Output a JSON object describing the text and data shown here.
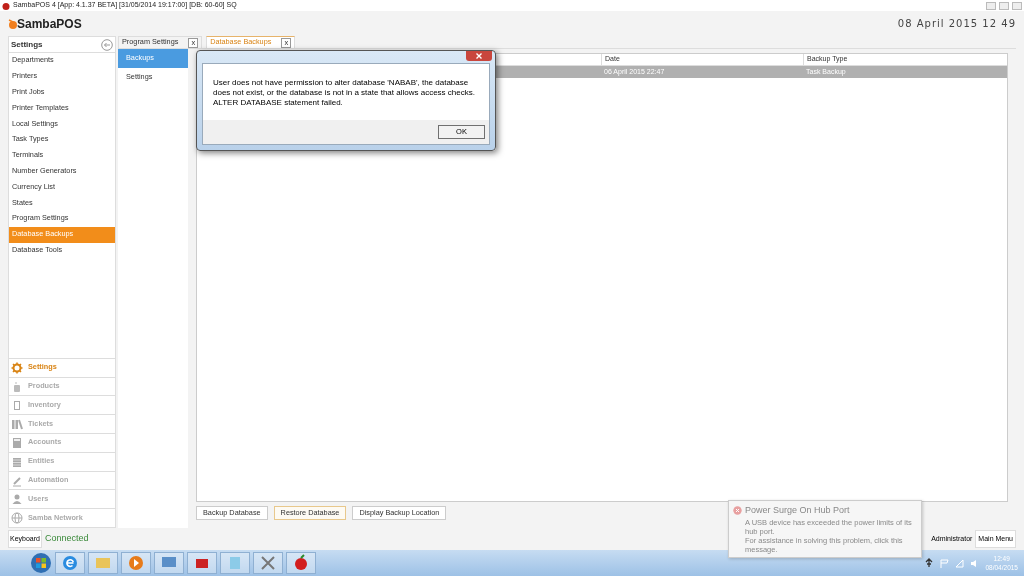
{
  "window": {
    "title": "SambaPOS 4 [App: 4.1.37 BETA] [31/05/2014 19:17:00] [DB: 60-60] SQ"
  },
  "header": {
    "logo": "SambaPOS",
    "clock": "08 April 2015 12 49"
  },
  "sidebar": {
    "title": "Settings",
    "items": [
      {
        "label": "Departments",
        "selected": false
      },
      {
        "label": "Printers",
        "selected": false
      },
      {
        "label": "Print Jobs",
        "selected": false
      },
      {
        "label": "Printer Templates",
        "selected": false
      },
      {
        "label": "Local Settings",
        "selected": false
      },
      {
        "label": "Task Types",
        "selected": false
      },
      {
        "label": "Terminals",
        "selected": false
      },
      {
        "label": "Number Generators",
        "selected": false
      },
      {
        "label": "Currency List",
        "selected": false
      },
      {
        "label": "States",
        "selected": false
      },
      {
        "label": "Program Settings",
        "selected": false
      },
      {
        "label": "Database Backups",
        "selected": true
      },
      {
        "label": "Database Tools",
        "selected": false
      }
    ]
  },
  "modules": [
    {
      "label": "Settings",
      "kind": "gear",
      "selected": true
    },
    {
      "label": "Products",
      "kind": "cup",
      "selected": false
    },
    {
      "label": "Inventory",
      "kind": "box",
      "selected": false
    },
    {
      "label": "Tickets",
      "kind": "books",
      "selected": false
    },
    {
      "label": "Accounts",
      "kind": "calculator",
      "selected": false
    },
    {
      "label": "Entities",
      "kind": "table",
      "selected": false
    },
    {
      "label": "Automation",
      "kind": "pen",
      "selected": false
    },
    {
      "label": "Users",
      "kind": "user",
      "selected": false
    },
    {
      "label": "Samba Network",
      "kind": "globe",
      "selected": false
    }
  ],
  "tabs": [
    {
      "label": "Program Settings",
      "close": "x",
      "selected": false
    },
    {
      "label": "Database Backups",
      "close": "x",
      "selected": true
    }
  ],
  "subnav": [
    {
      "label": "Backups",
      "selected": true
    },
    {
      "label": "Settings",
      "selected": false
    }
  ],
  "table": {
    "columns": [
      "Date",
      "Backup Type"
    ],
    "rows": [
      {
        "cells": [
          "06 April 2015 22:47",
          "Task Backup"
        ],
        "selected": true
      }
    ]
  },
  "buttons": [
    {
      "label": "Backup Database",
      "focused": false
    },
    {
      "label": "Restore Database",
      "focused": true
    },
    {
      "label": "Display Backup Location",
      "focused": false
    }
  ],
  "dialog": {
    "message": "User does not have permission to alter database 'NABAB', the database does not exist, or the database is not in a state that allows access checks.",
    "detail": "ALTER DATABASE statement failed.",
    "ok": "OK"
  },
  "status_bar": {
    "keyboard": "Keyboard",
    "connection": "Connected",
    "user": "Administrator",
    "main_menu": "Main Menu"
  },
  "notification": {
    "title": "Power Surge On Hub Port",
    "lines": [
      "A USB device has exceeded the power limits of its hub port.",
      "For assistance in solving this problem, click this message."
    ]
  },
  "taskbar": {
    "time": "12:49",
    "date": "08/04/2015"
  }
}
